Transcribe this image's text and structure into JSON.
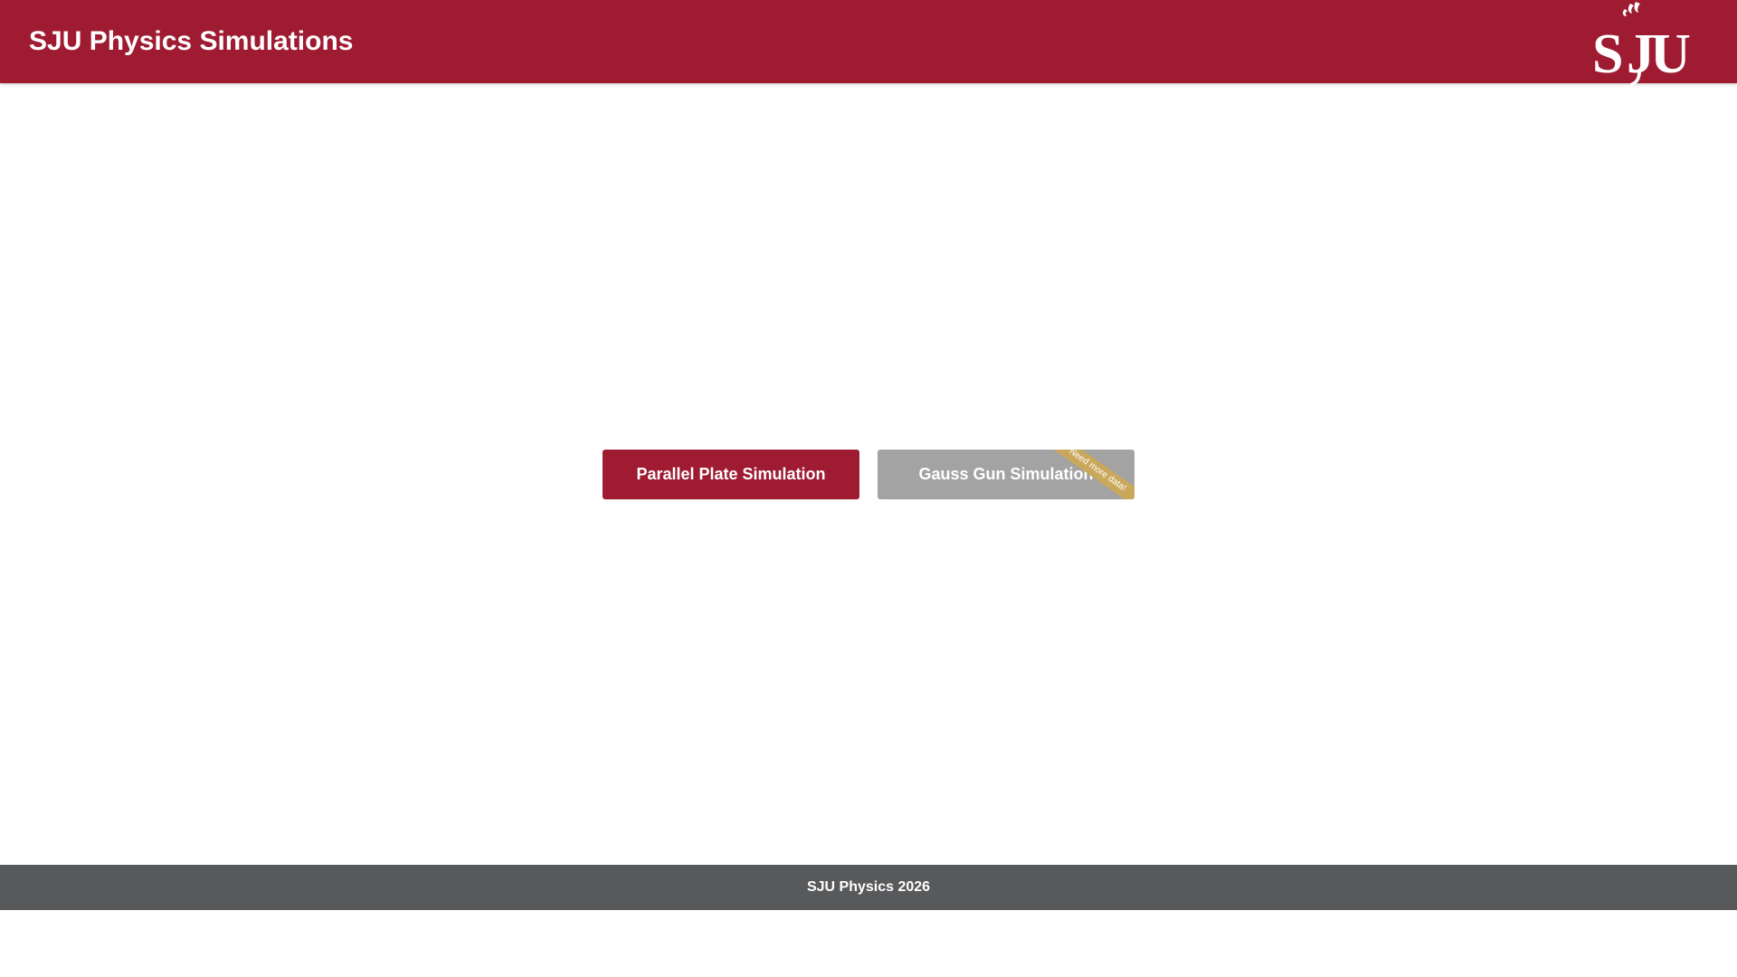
{
  "header": {
    "title": "SJU Physics Simulations",
    "logo_text": "SJU",
    "background_color": "#9e1b32"
  },
  "main": {
    "buttons": [
      {
        "label": "Parallel Plate Simulation",
        "state": "enabled",
        "color": "#9e1b32"
      },
      {
        "label": "Gauss Gun Simulation",
        "state": "disabled",
        "color": "#a3a3a3",
        "ribbon": "Need more data!",
        "ribbon_color": "#c9a85c"
      }
    ]
  },
  "footer": {
    "text": "SJU Physics 2026",
    "background_color": "#58595b"
  }
}
